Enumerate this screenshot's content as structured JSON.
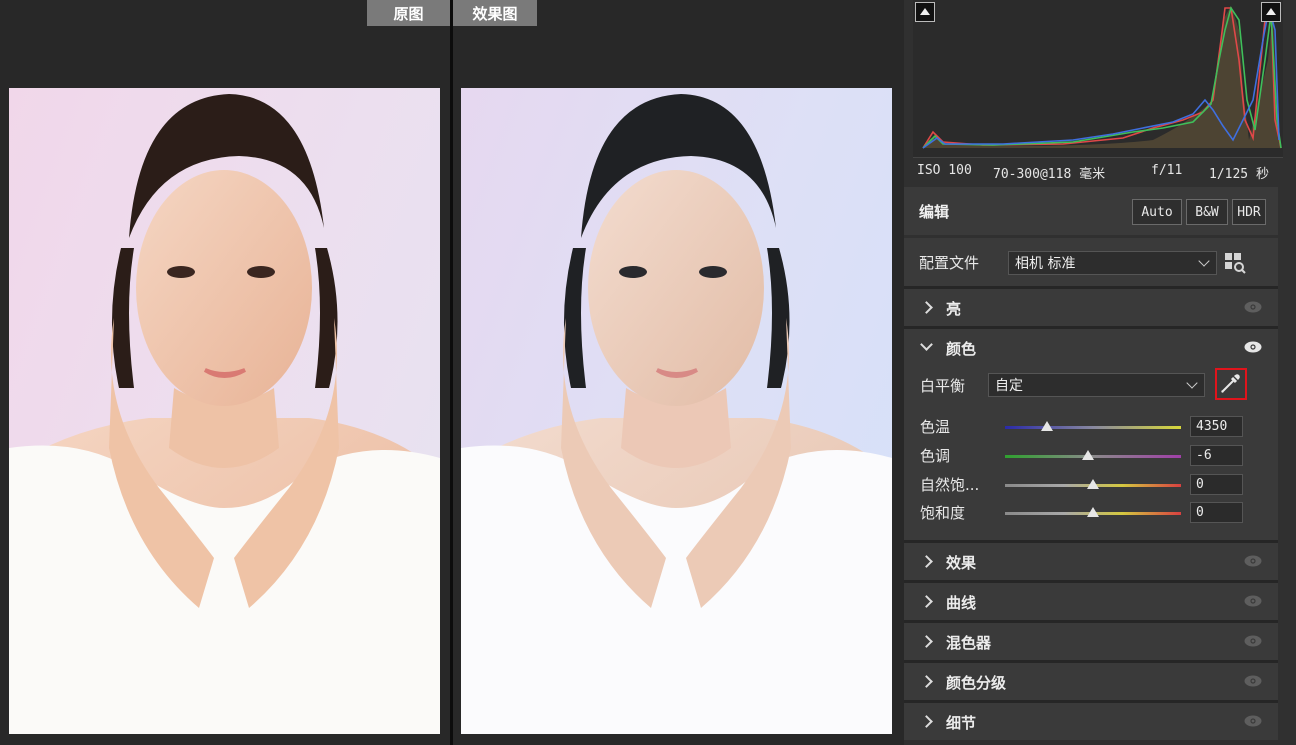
{
  "preview": {
    "tab_before": "原图",
    "tab_after": "效果图"
  },
  "histogram": {
    "exif": {
      "iso": "ISO 100",
      "lens": "70-300@118 毫米",
      "aperture": "f/11",
      "shutter": "1/125 秒"
    }
  },
  "edit": {
    "title": "编辑",
    "buttons": {
      "auto": "Auto",
      "bw": "B&W",
      "hdr": "HDR"
    }
  },
  "profile": {
    "label": "配置文件",
    "value": "相机 标准"
  },
  "panels": {
    "light": "亮",
    "color": "颜色",
    "effects": "效果",
    "curve": "曲线",
    "mixer": "混色器",
    "grading": "颜色分级",
    "detail": "细节"
  },
  "color": {
    "wb_label": "白平衡",
    "wb_value": "自定",
    "sliders": [
      {
        "label": "色温",
        "value": "4350",
        "position": 0.24,
        "gradient": [
          "#2a2aa8",
          "#8888a0",
          "#d8d83a"
        ]
      },
      {
        "label": "色调",
        "value": "-6",
        "position": 0.47,
        "gradient": [
          "#2fa02f",
          "#8a8a8a",
          "#a040a8"
        ]
      },
      {
        "label": "自然饱...",
        "value": "0",
        "position": 0.5,
        "gradient": [
          "#8a8a8a",
          "#a8a8a8",
          "#d4c840",
          "#d84040"
        ]
      },
      {
        "label": "饱和度",
        "value": "0",
        "position": 0.5,
        "gradient": [
          "#8a8a8a",
          "#a8a8a8",
          "#d4c840",
          "#d84040"
        ]
      }
    ]
  },
  "colors": {
    "highlight_border": "#e0141c",
    "panel_bg": "#3a3a3a"
  }
}
